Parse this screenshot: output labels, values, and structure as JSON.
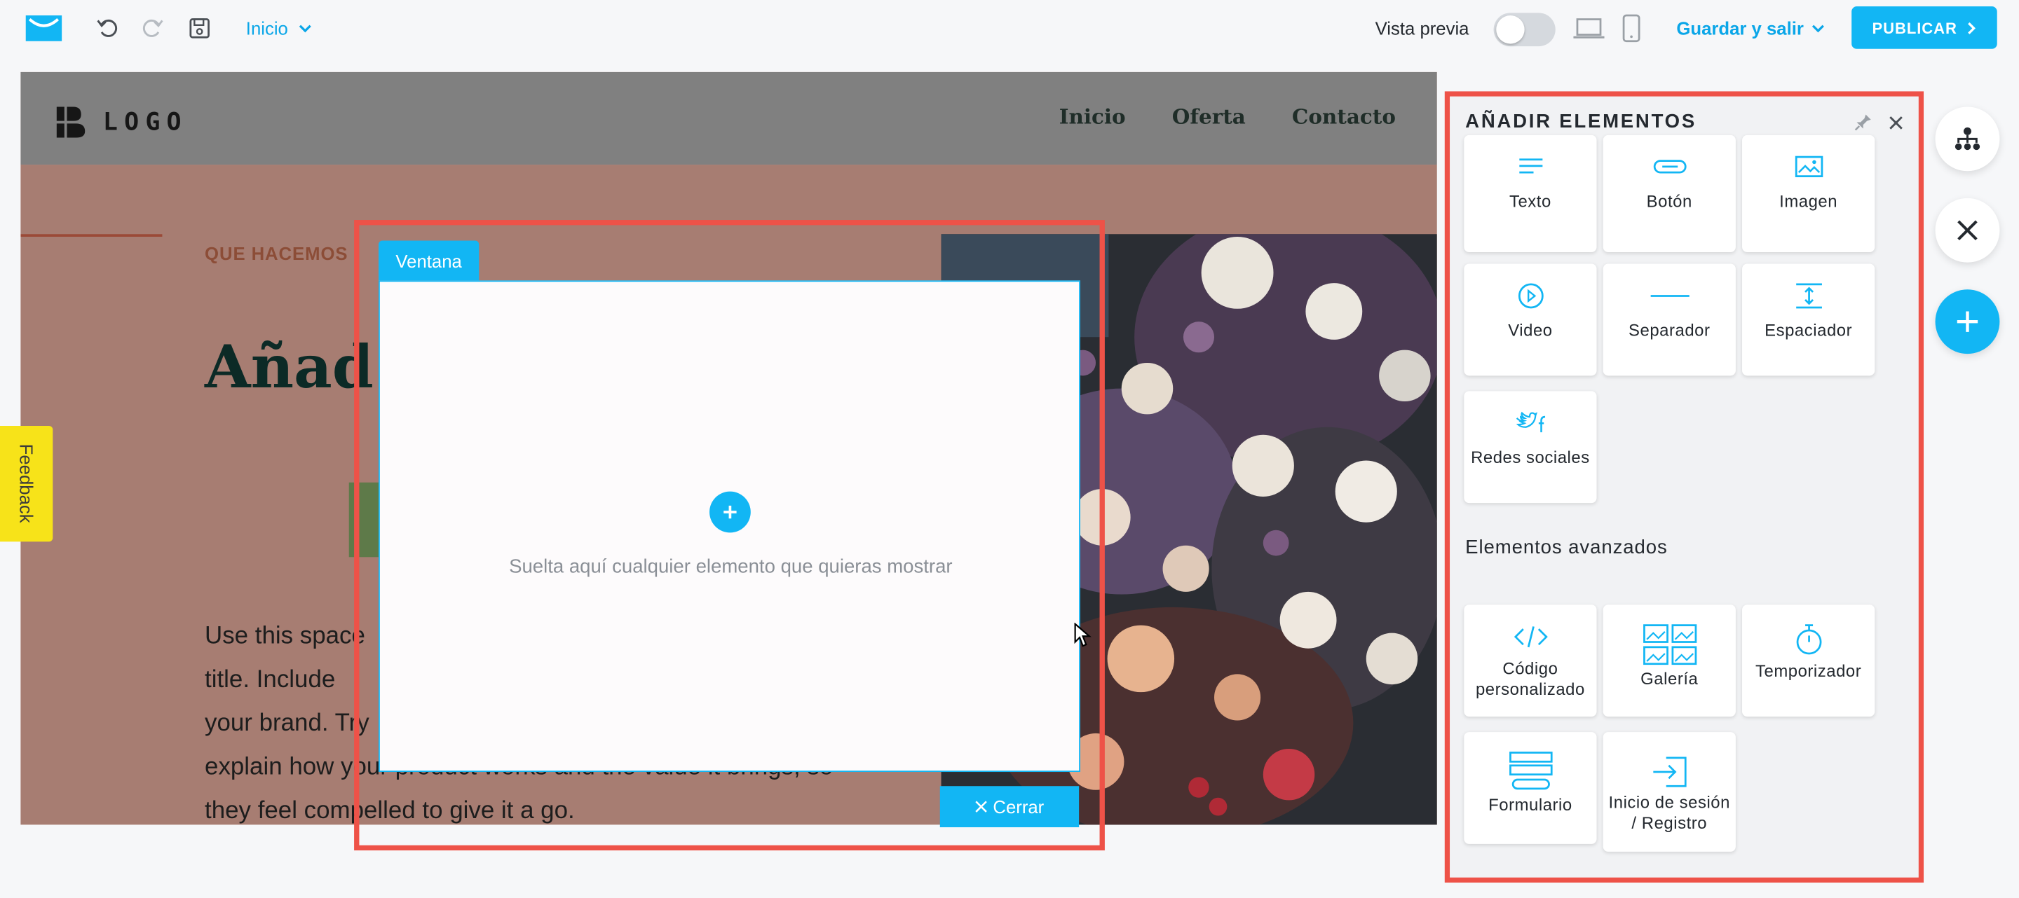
{
  "topbar": {
    "page_select": "Inicio",
    "preview_label": "Vista previa",
    "save_exit": "Guardar y salir",
    "publish": "PUBLICAR"
  },
  "site": {
    "logo_text": "LOGO",
    "nav": [
      "Inicio",
      "Oferta",
      "Contacto"
    ],
    "eyebrow": "QUE HACEMOS",
    "title": "Añad",
    "body_lines": [
      "Use this space",
      "title. Include",
      "your brand. Try",
      "explain how your product works and the value it brings, so",
      "they feel compelled to give it a go."
    ]
  },
  "feedback": "Feedback",
  "popup": {
    "tab": "Ventana",
    "drop_text": "Suelta aquí cualquier elemento que quieras mostrar",
    "close": "Cerrar"
  },
  "panel": {
    "title": "AÑADIR ELEMENTOS",
    "basic": [
      {
        "label": "Texto",
        "icon": "text-icon"
      },
      {
        "label": "Botón",
        "icon": "button-icon"
      },
      {
        "label": "Imagen",
        "icon": "image-icon"
      },
      {
        "label": "Video",
        "icon": "video-icon"
      },
      {
        "label": "Separador",
        "icon": "separator-icon"
      },
      {
        "label": "Espaciador",
        "icon": "spacer-icon"
      },
      {
        "label": "Redes sociales",
        "icon": "social-icon"
      }
    ],
    "advanced_title": "Elementos avanzados",
    "advanced": [
      {
        "label": "Código personalizado",
        "icon": "code-icon"
      },
      {
        "label": "Galería",
        "icon": "gallery-icon"
      },
      {
        "label": "Temporizador",
        "icon": "timer-icon"
      },
      {
        "label": "Formulario",
        "icon": "form-icon"
      },
      {
        "label": "Inicio de sesión / Registro",
        "icon": "login-icon"
      }
    ]
  },
  "colors": {
    "accent": "#12b6f4",
    "highlight": "#ee5248",
    "feedback": "#f7e319"
  }
}
